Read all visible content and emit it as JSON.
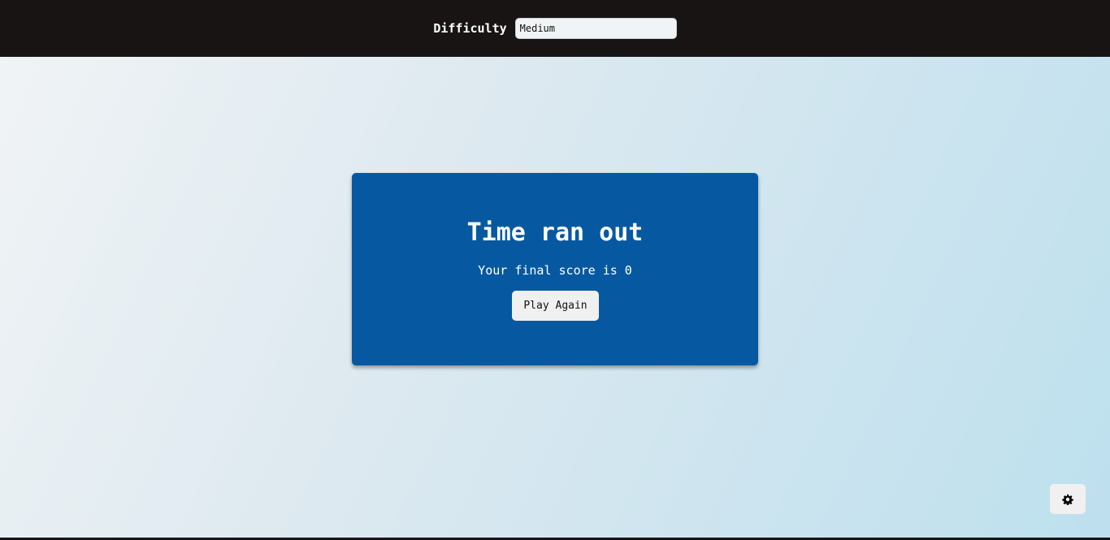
{
  "settings": {
    "difficulty_label": "Difficulty",
    "difficulty_value": "Medium",
    "difficulty_options": [
      "Medium"
    ]
  },
  "end_game": {
    "title": "Time ran out",
    "score_message": "Your final score is 0",
    "final_score": 0,
    "play_again_label": "Play Again"
  },
  "settings_button": {
    "icon": "gear-icon"
  },
  "colors": {
    "header_background": "#191414",
    "card_background": "#0659a0",
    "button_background": "#f0f0f0",
    "page_gradient_start": "#f1f4f6",
    "page_gradient_end": "#bde0ee"
  }
}
